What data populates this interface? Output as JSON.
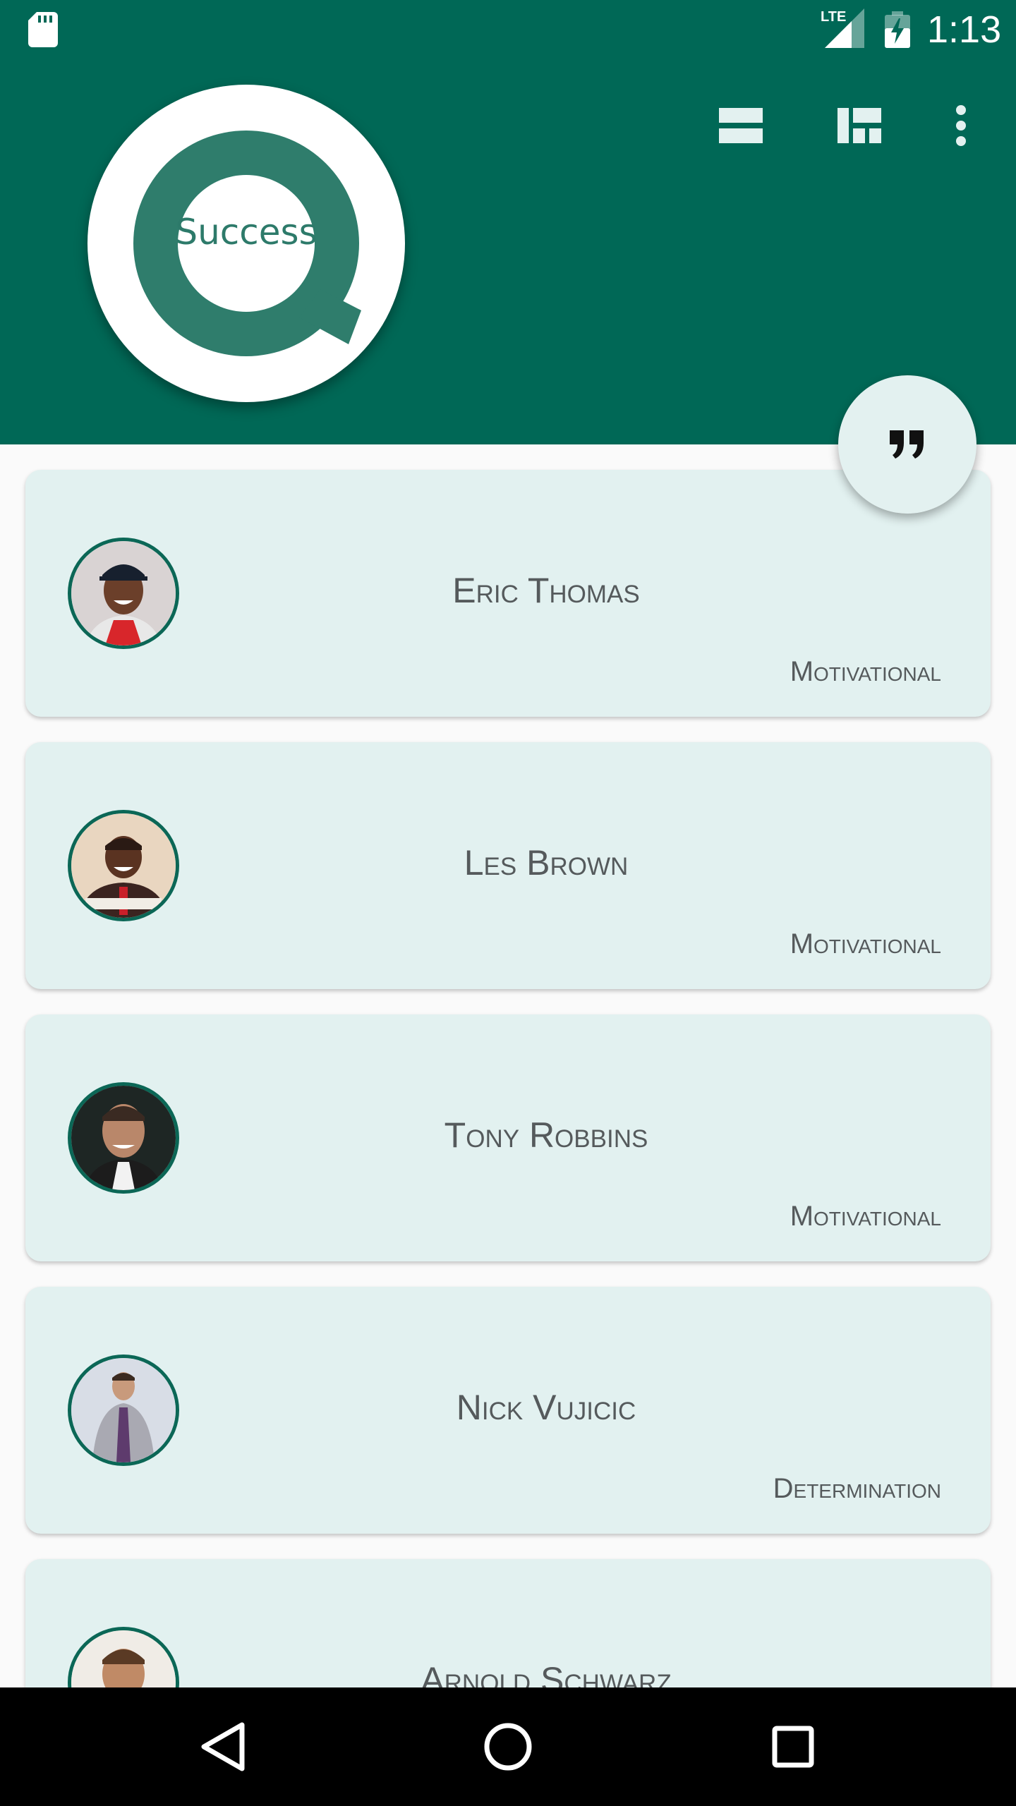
{
  "status_bar": {
    "network_label": "LTE",
    "time": "1:13"
  },
  "header": {
    "logo_text": "Success",
    "actions": [
      {
        "icon": "list-view-icon"
      },
      {
        "icon": "grid-view-icon"
      },
      {
        "icon": "more-vert-icon"
      }
    ]
  },
  "fab": {
    "icon": "format-quote-icon"
  },
  "people": [
    {
      "name": "Eric Thomas",
      "category": "Motivational"
    },
    {
      "name": "Les Brown",
      "category": "Motivational"
    },
    {
      "name": "Tony Robbins",
      "category": "Motivational"
    },
    {
      "name": "Nick Vujicic",
      "category": "Determination"
    },
    {
      "name": "Arnold Schwarz",
      "category": ""
    }
  ],
  "nav": {
    "buttons": [
      {
        "icon": "back-icon"
      },
      {
        "icon": "home-icon"
      },
      {
        "icon": "recents-icon"
      }
    ]
  },
  "colors": {
    "primary": "#006856",
    "card_background": "#e2f1f0",
    "text": "#555a5c"
  }
}
